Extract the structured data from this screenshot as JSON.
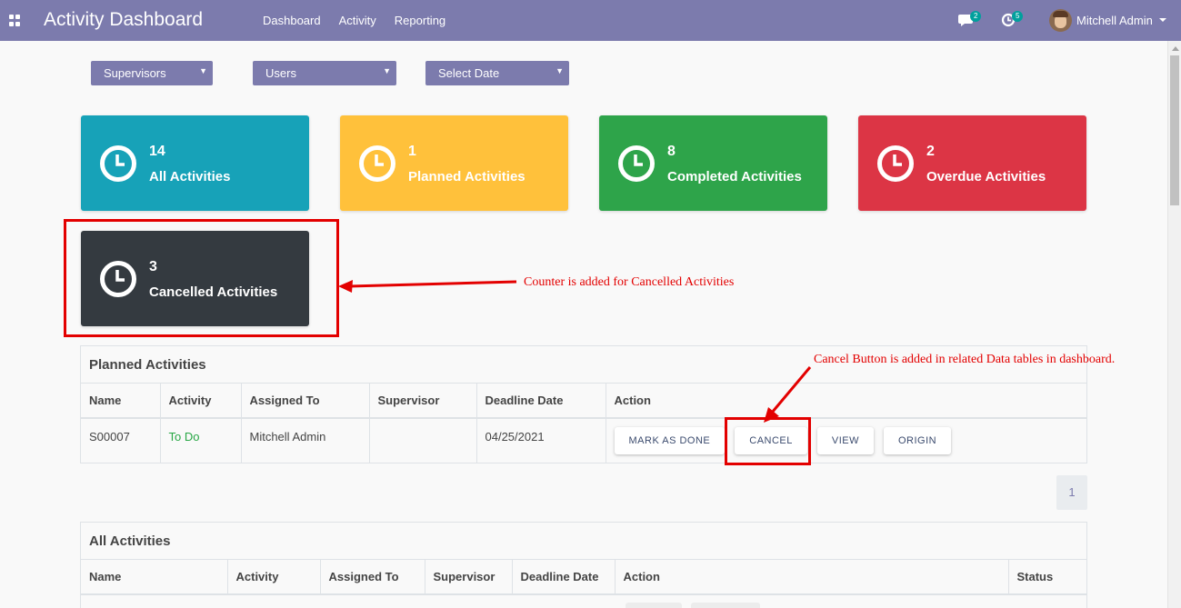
{
  "navbar": {
    "title": "Activity Dashboard",
    "menu": [
      "Dashboard",
      "Activity",
      "Reporting"
    ],
    "messages_count": "2",
    "activities_count": "5",
    "user_name": "Mitchell Admin",
    "bg_color": "#7c7bad"
  },
  "filters": {
    "supervisors": "Supervisors",
    "users": "Users",
    "date": "Select Date"
  },
  "cards": [
    {
      "count": "14",
      "label": "All Activities",
      "color": "#17a2b8"
    },
    {
      "count": "1",
      "label": "Planned Activities",
      "color": "#ffc13b"
    },
    {
      "count": "8",
      "label": "Completed Activities",
      "color": "#2ea44a"
    },
    {
      "count": "2",
      "label": "Overdue Activities",
      "color": "#dc3545"
    },
    {
      "count": "3",
      "label": "Cancelled Activities",
      "color": "#343a40"
    }
  ],
  "annotations": {
    "counter_note": "Counter is added for Cancelled Activities",
    "cancel_note": "Cancel Button is added in related Data tables in dashboard.",
    "color": "#e30000"
  },
  "planned": {
    "title": "Planned Activities",
    "columns": [
      "Name",
      "Activity",
      "Assigned To",
      "Supervisor",
      "Deadline Date",
      "Action"
    ],
    "row": {
      "name": "S00007",
      "activity": "To Do",
      "assigned_to": "Mitchell Admin",
      "supervisor": "",
      "deadline": "04/25/2021"
    },
    "actions": [
      "MARK AS DONE",
      "CANCEL",
      "VIEW",
      "ORIGIN"
    ]
  },
  "pagination": {
    "current": "1"
  },
  "all": {
    "title": "All Activities",
    "columns": [
      "Name",
      "Activity",
      "Assigned To",
      "Supervisor",
      "Deadline Date",
      "Action",
      "Status"
    ]
  }
}
